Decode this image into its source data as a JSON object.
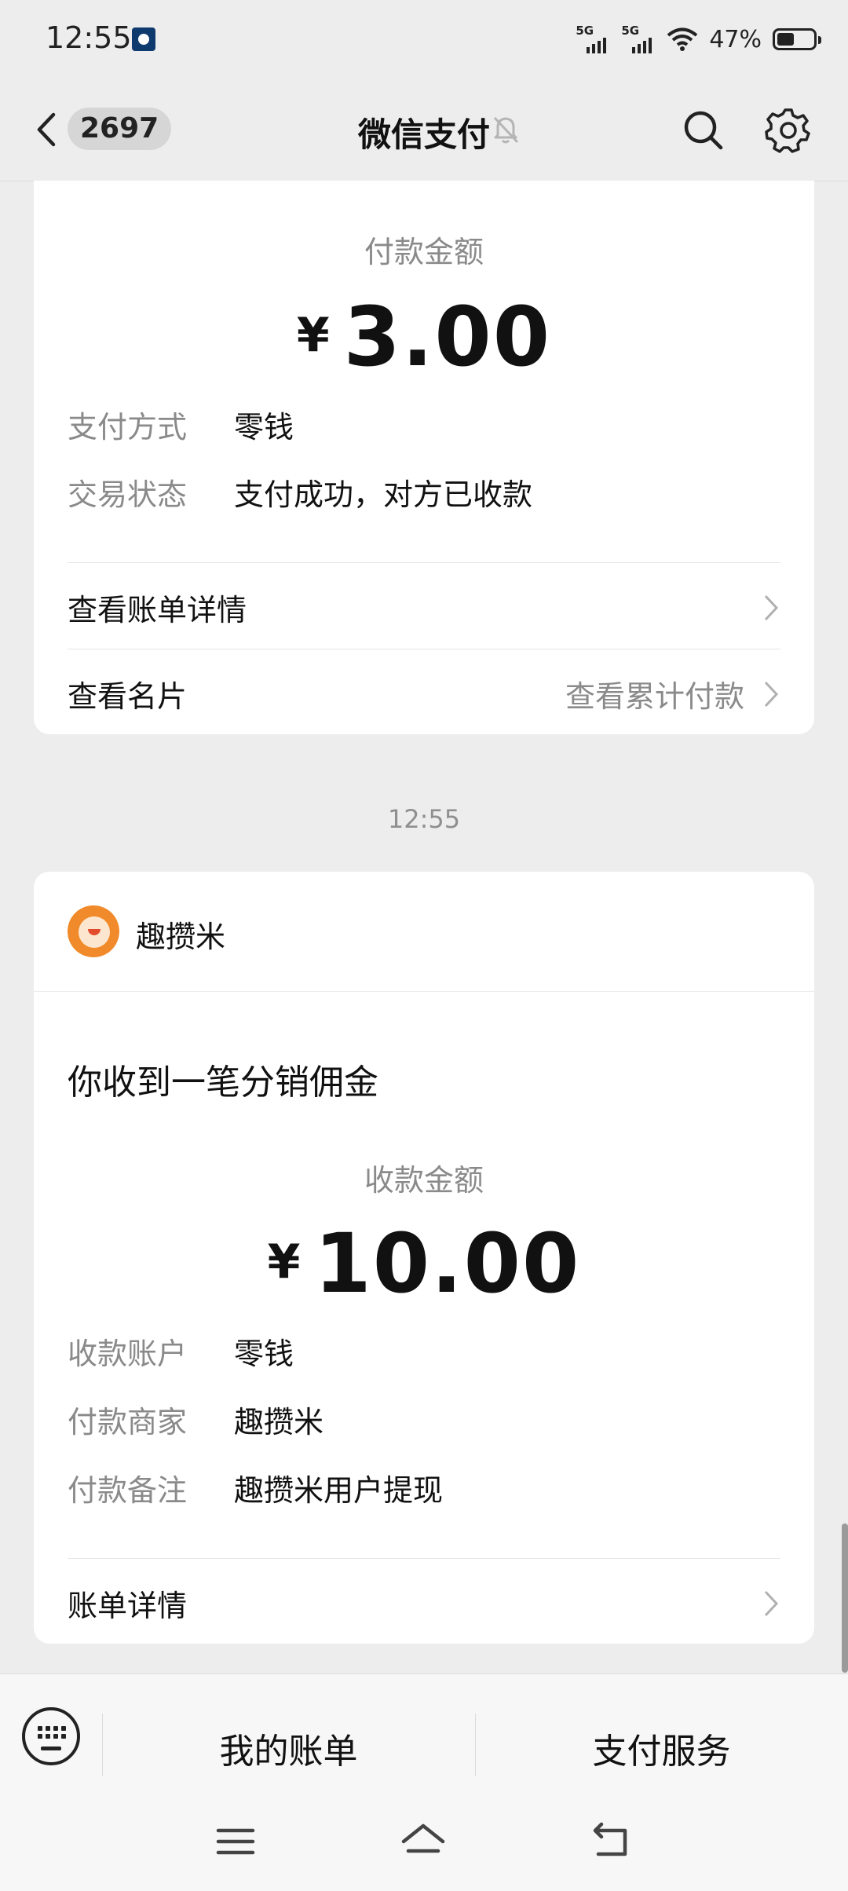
{
  "status_bar": {
    "time": "12:55",
    "signal1_label": "5G",
    "signal2_label": "5G",
    "battery_text": "47%",
    "battery_level": 0.47
  },
  "nav": {
    "unread_count": "2697",
    "title": "微信支付"
  },
  "payment_card": {
    "amount_label": "付款金额",
    "currency": "¥",
    "amount": "3.00",
    "details": [
      {
        "key": "支付方式",
        "value": "零钱"
      },
      {
        "key": "交易状态",
        "value": "支付成功，对方已收款"
      }
    ],
    "link_bill_detail": "查看账单详情",
    "link_card": "查看名片",
    "link_cumulative": "查看累计付款"
  },
  "timestamp": "12:55",
  "receipt_card": {
    "merchant_name": "趣攒米",
    "notice_title": "你收到一笔分销佣金",
    "amount_label": "收款金额",
    "currency": "¥",
    "amount": "10.00",
    "details": [
      {
        "key": "收款账户",
        "value": "零钱"
      },
      {
        "key": "付款商家",
        "value": "趣攒米"
      },
      {
        "key": "付款备注",
        "value": "趣攒米用户提现"
      }
    ],
    "link_bill_detail": "账单详情"
  },
  "toolbar": {
    "my_bills": "我的账单",
    "pay_services": "支付服务"
  }
}
